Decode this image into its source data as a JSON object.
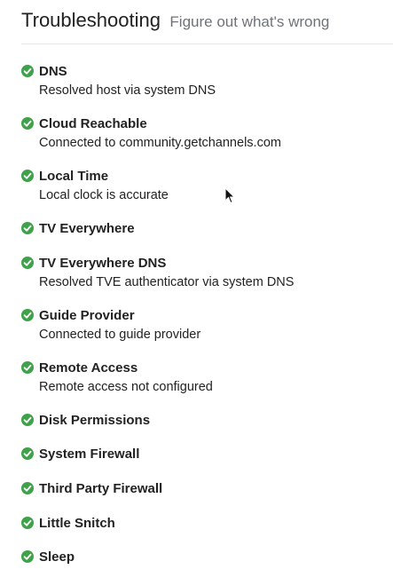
{
  "header": {
    "title": "Troubleshooting",
    "subtitle": "Figure out what's wrong"
  },
  "status_color": "#3fa24a",
  "checks": [
    {
      "name": "DNS",
      "detail": "Resolved host via system DNS",
      "status": "ok"
    },
    {
      "name": "Cloud Reachable",
      "detail": "Connected to community.getchannels.com",
      "status": "ok"
    },
    {
      "name": "Local Time",
      "detail": "Local clock is accurate",
      "status": "ok"
    },
    {
      "name": "TV Everywhere",
      "detail": "",
      "status": "ok"
    },
    {
      "name": "TV Everywhere DNS",
      "detail": "Resolved TVE authenticator via system DNS",
      "status": "ok"
    },
    {
      "name": "Guide Provider",
      "detail": "Connected to guide provider",
      "status": "ok"
    },
    {
      "name": "Remote Access",
      "detail": "Remote access not configured",
      "status": "ok"
    },
    {
      "name": "Disk Permissions",
      "detail": "",
      "status": "ok"
    },
    {
      "name": "System Firewall",
      "detail": "",
      "status": "ok"
    },
    {
      "name": "Third Party Firewall",
      "detail": "",
      "status": "ok"
    },
    {
      "name": "Little Snitch",
      "detail": "",
      "status": "ok"
    },
    {
      "name": "Sleep",
      "detail": "",
      "status": "ok"
    }
  ],
  "icons": {
    "status_ok": "check-circle-icon",
    "pointer": "mouse-pointer-icon"
  }
}
